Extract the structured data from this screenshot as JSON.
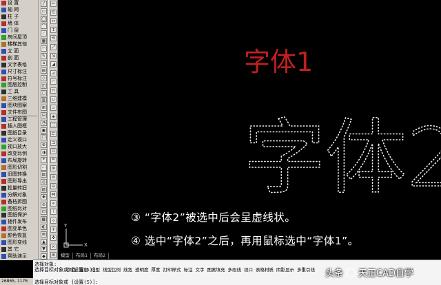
{
  "palette": {
    "items": [
      {
        "label": "设  置",
        "icon": "settings-icon",
        "color": "#b03030"
      },
      {
        "label": "轴  网",
        "icon": "grid-icon",
        "color": "#3050b0"
      },
      {
        "label": "柱  子",
        "icon": "column-icon",
        "color": "#303030"
      },
      {
        "label": "墙  体",
        "icon": "wall-icon",
        "color": "#b03030"
      },
      {
        "label": "门  窗",
        "icon": "door-icon",
        "color": "#3050b0"
      },
      {
        "label": "房间屋顶",
        "icon": "room-icon",
        "color": "#30a030"
      },
      {
        "label": "楼梯其他",
        "icon": "stair-icon",
        "color": "#b07030"
      },
      {
        "label": "立  面",
        "icon": "elevation-icon",
        "color": "#3050b0"
      },
      {
        "label": "剖  面",
        "icon": "section-icon",
        "color": "#b03030"
      },
      {
        "label": "文字表格",
        "icon": "text-icon",
        "color": "#303030"
      },
      {
        "label": "尺寸标注",
        "icon": "dimension-icon",
        "color": "#3050b0"
      },
      {
        "label": "符号标注",
        "icon": "symbol-icon",
        "color": "#b03030"
      },
      {
        "label": "图层控制",
        "icon": "layer-icon",
        "color": "#30a030"
      },
      {
        "label": "工  具",
        "icon": "tool-icon",
        "color": "#303030"
      },
      {
        "label": "三维建模",
        "icon": "3d-icon",
        "color": "#b07030"
      },
      {
        "label": "图块图案",
        "icon": "block-icon",
        "color": "#3050b0"
      },
      {
        "label": "文件布图",
        "icon": "file-icon",
        "color": "#b03030"
      },
      {
        "label": "工程管理",
        "icon": "project-icon",
        "color": "#3050b0"
      },
      {
        "label": "插入图框",
        "icon": "frame-icon",
        "color": "#b03030"
      },
      {
        "label": "图纸目录",
        "icon": "catalog-icon",
        "color": "#303030"
      },
      {
        "label": "定义视口",
        "icon": "viewport-icon",
        "color": "#3050b0"
      },
      {
        "label": "视口放大",
        "icon": "zoom-icon",
        "color": "#30a030"
      },
      {
        "label": "改变比例",
        "icon": "scale-icon",
        "color": "#b03030"
      },
      {
        "label": "布局旋转",
        "icon": "rotate-icon",
        "color": "#3050b0"
      },
      {
        "label": "图形切割",
        "icon": "cut-icon",
        "color": "#b07030"
      },
      {
        "label": "旧图转换",
        "icon": "convert-icon",
        "color": "#3050b0"
      },
      {
        "label": "图形导出",
        "icon": "export-icon",
        "color": "#b03030"
      },
      {
        "label": "批量转旧",
        "icon": "batch-icon",
        "color": "#303030"
      },
      {
        "label": "分解对象",
        "icon": "explode-icon",
        "color": "#3050b0"
      },
      {
        "label": "备档拆图",
        "icon": "archive-icon",
        "color": "#b03030"
      },
      {
        "label": "图纸比对",
        "icon": "compare-icon",
        "color": "#30a030"
      },
      {
        "label": "图纸保护",
        "icon": "lock-icon",
        "color": "#303030"
      },
      {
        "label": "插件发布",
        "icon": "plugin-icon",
        "color": "#3050b0"
      },
      {
        "label": "图变单色",
        "icon": "mono-icon",
        "color": "#b03030"
      },
      {
        "label": "颜色恢复",
        "icon": "color-icon",
        "color": "#b07030"
      },
      {
        "label": "图形变线",
        "icon": "line-icon",
        "color": "#3050b0"
      },
      {
        "label": "其  它",
        "icon": "other-icon",
        "color": "#303030"
      },
      {
        "label": "帮助演示",
        "icon": "help-icon",
        "color": "#3050b0"
      }
    ]
  },
  "drawing": {
    "small_text": "字体1",
    "small_text_color": "#c0201e",
    "large_text": "字体2",
    "large_text_color": "#e8e8e8"
  },
  "annotations": {
    "line1": "③  “字体2”被选中后会呈虚线状。",
    "line2": "④   选中“字体2”之后，再用鼠标选中“字体1”。"
  },
  "layout_tabs": [
    "模型",
    "布局1",
    "布局2"
  ],
  "command": {
    "line1": "选择对象:",
    "line2": "选择目标对象或 [设置(S)]:",
    "line3": "选择目标对象或 [设置(S)]:",
    "prop_tools": [
      "颜色",
      "图层",
      "线型",
      "线型比例",
      "线宽",
      "透明度",
      "厚度",
      "打印样式",
      "标注",
      "文字",
      "图案填充",
      "多段线",
      "视口",
      "表格材质",
      "阴影显示",
      "多重引线"
    ]
  },
  "status": {
    "coords": "26865, 1176"
  },
  "watermark": {
    "prefix": "头条",
    "name": "天正CAD自学"
  },
  "ucs": {
    "x_label": "X",
    "y_label": "Y"
  }
}
